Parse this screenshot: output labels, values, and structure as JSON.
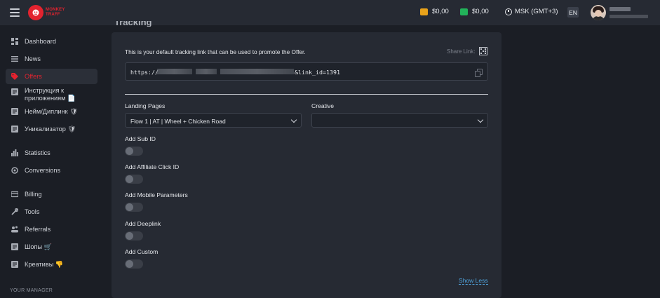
{
  "header": {
    "menu_icon": "hamburger-icon",
    "logo": {
      "line1": "MONKEY",
      "line2": "TRAFF",
      "color": "#e3232f"
    },
    "wallets": [
      {
        "icon": "wallet-icon",
        "color": "#e8a21a",
        "amount": "$0,00"
      },
      {
        "icon": "wallet-icon",
        "color": "#22b35a",
        "amount": "$0,00"
      }
    ],
    "timezone": "MSK (GMT+3)",
    "language": "EN"
  },
  "sidebar": {
    "items": [
      {
        "label": "Dashboard",
        "icon": "dashboard-icon"
      },
      {
        "label": "News",
        "icon": "list-icon"
      },
      {
        "label": "Offers",
        "icon": "tag-icon",
        "active": true
      },
      {
        "label": "Инструкция к приложениям 📄",
        "icon": "document-icon"
      },
      {
        "label": "Нейм/Диплинк 🛡",
        "icon": "document-icon"
      },
      {
        "label": "Уникализатор 🛡",
        "icon": "document-icon"
      },
      {
        "label": "Statistics",
        "icon": "bar-chart-icon"
      },
      {
        "label": "Conversions",
        "icon": "conversions-icon"
      },
      {
        "label": "Billing",
        "icon": "card-icon"
      },
      {
        "label": "Tools",
        "icon": "wrench-icon"
      },
      {
        "label": "Referrals",
        "icon": "referrals-icon"
      },
      {
        "label": "Шопы 🛒",
        "icon": "document-icon"
      },
      {
        "label": "Креативы 👎",
        "icon": "document-icon"
      }
    ],
    "manager_label": "YOUR MANAGER"
  },
  "main": {
    "description": "This is your default tracking link that can be used to promote the Offer.",
    "share_label": "Share Link:",
    "tracking_link": {
      "prefix": "https://",
      "suffix": "&link_id=1391"
    },
    "landing_pages": {
      "label": "Landing Pages",
      "value": "Flow 1 | AT | Wheel + Chicken Road"
    },
    "creative": {
      "label": "Creative",
      "value": ""
    },
    "toggles": [
      {
        "label": "Add Sub ID",
        "on": false
      },
      {
        "label": "Add Affiliate Click ID",
        "on": false
      },
      {
        "label": "Add Mobile Parameters",
        "on": false
      },
      {
        "label": "Add Deeplink",
        "on": false
      },
      {
        "label": "Add Custom",
        "on": false
      }
    ],
    "show_less": "Show Less"
  }
}
